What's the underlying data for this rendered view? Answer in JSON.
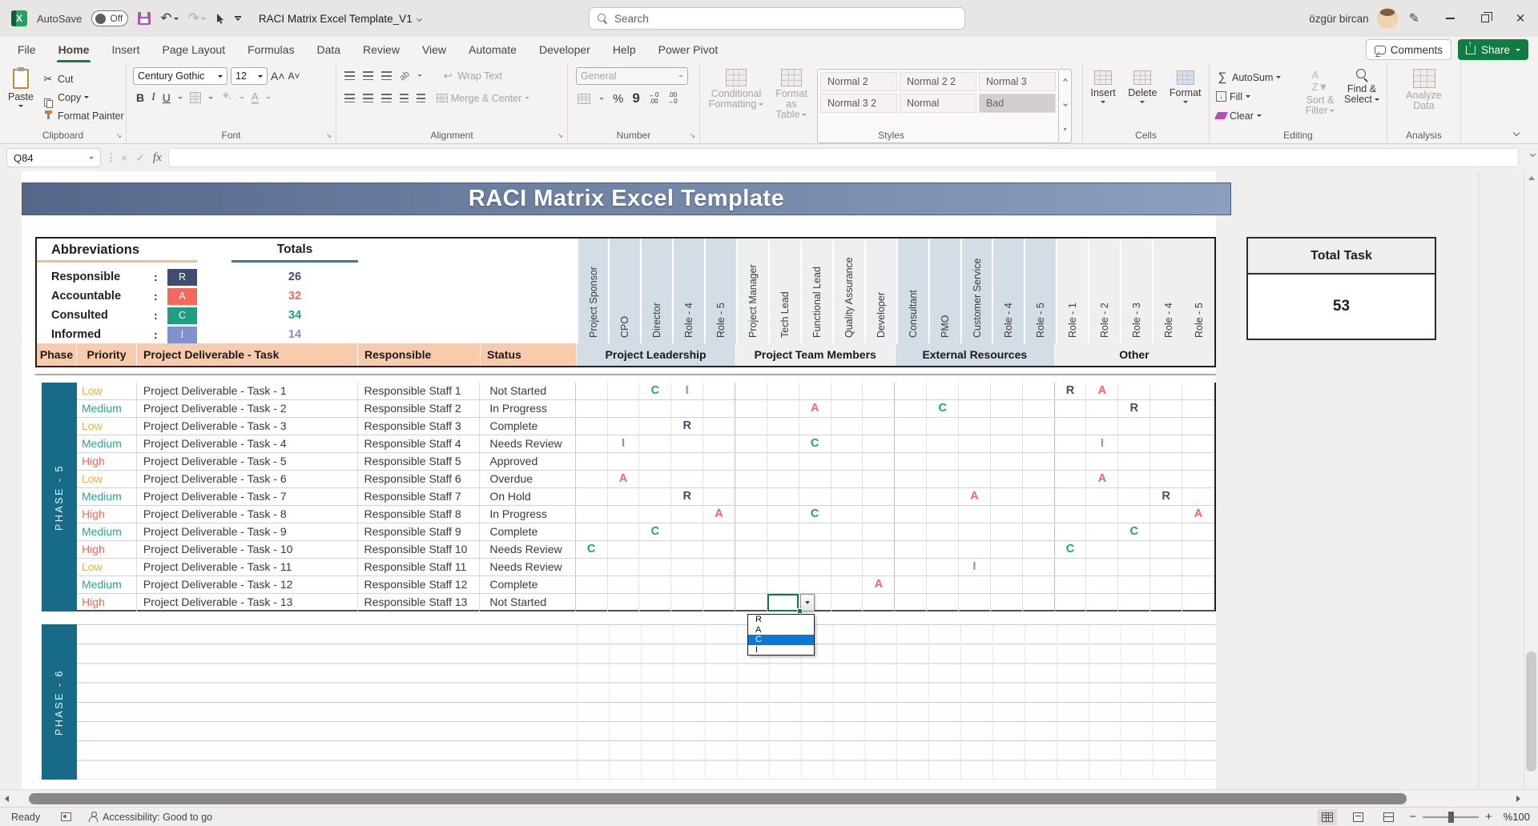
{
  "titlebar": {
    "autosave_label": "AutoSave",
    "autosave_state": "Off",
    "doc_title": "RACI Matrix Excel Template_V1",
    "search_placeholder": "Search",
    "user_name": "özgür bircan"
  },
  "tabs": {
    "items": [
      "File",
      "Home",
      "Insert",
      "Page Layout",
      "Formulas",
      "Data",
      "Review",
      "View",
      "Automate",
      "Developer",
      "Help",
      "Power Pivot"
    ],
    "active": "Home",
    "comments_label": "Comments",
    "share_label": "Share"
  },
  "ribbon": {
    "clipboard": {
      "label": "Clipboard",
      "paste": "Paste",
      "cut": "Cut",
      "copy": "Copy",
      "format_painter": "Format Painter"
    },
    "font": {
      "label": "Font",
      "family": "Century Gothic",
      "size": "12"
    },
    "alignment": {
      "label": "Alignment",
      "wrap_text": "Wrap Text",
      "merge_center": "Merge & Center"
    },
    "number": {
      "label": "Number",
      "format": "General"
    },
    "styles": {
      "label": "Styles",
      "conditional_formatting_1": "Conditional",
      "conditional_formatting_2": "Formatting",
      "format_as_table_1": "Format as",
      "format_as_table_2": "Table",
      "gallery": [
        "Normal 2",
        "Normal 2 2",
        "Normal 3",
        "Normal 3 2",
        "Normal",
        "Bad"
      ]
    },
    "cells": {
      "label": "Cells",
      "insert": "Insert",
      "delete": "Delete",
      "format": "Format"
    },
    "editing": {
      "label": "Editing",
      "autosum": "AutoSum",
      "fill": "Fill",
      "clear": "Clear",
      "sort_filter_1": "Sort &",
      "sort_filter_2": "Filter",
      "find_select_1": "Find &",
      "find_select_2": "Select"
    },
    "analysis": {
      "label": "Analysis",
      "analyze_1": "Analyze",
      "analyze_2": "Data"
    }
  },
  "formula_bar": {
    "name_box": "Q84"
  },
  "sheet": {
    "banner_title": "RACI Matrix Excel Template",
    "abbreviations": {
      "title": "Abbreviations",
      "totals_title": "Totals",
      "items": [
        {
          "label": "Responsible",
          "letter": "R",
          "total": "26"
        },
        {
          "label": "Accountable",
          "letter": "A",
          "total": "32"
        },
        {
          "label": "Consulted",
          "letter": "C",
          "total": "34"
        },
        {
          "label": "Informed",
          "letter": "I",
          "total": "14"
        }
      ]
    },
    "total_task": {
      "title": "Total Task",
      "value": "53"
    },
    "matrix": {
      "column_headers": {
        "phase": "Phase",
        "priority": "Priority",
        "task": "Project Deliverable - Task",
        "responsible": "Responsible",
        "status": "Status"
      },
      "groups": [
        {
          "label": "Project Leadership",
          "shade": "dark",
          "roles": [
            "Project Sponsor",
            "CPO",
            "Director",
            "Role - 4",
            "Role - 5"
          ]
        },
        {
          "label": "Project Team Members",
          "shade": "light",
          "roles": [
            "Project Manager",
            "Tech Lead",
            "Functional Lead",
            "Quality Assurance",
            "Developer"
          ]
        },
        {
          "label": "External Resources",
          "shade": "dark",
          "roles": [
            "Consultant",
            "PMO",
            "Customer Service",
            "Role - 4",
            "Role - 5"
          ]
        },
        {
          "label": "Other",
          "shade": "light",
          "roles": [
            "Role - 1",
            "Role - 2",
            "Role - 3",
            "Role - 4",
            "Role - 5"
          ]
        }
      ],
      "phase5_label": "PHASE - 5",
      "phase6_label": "PHASE - 6",
      "rows": [
        {
          "priority": "Low",
          "task": "Project Deliverable - Task - 1",
          "responsible": "Responsible Staff 1",
          "status": "Not Started",
          "marks": {
            "3": "C",
            "4": "I",
            "16": "R",
            "17": "A"
          }
        },
        {
          "priority": "Medium",
          "task": "Project Deliverable - Task - 2",
          "responsible": "Responsible Staff 2",
          "status": "In Progress",
          "marks": {
            "8": "A",
            "12": "C",
            "18": "R"
          }
        },
        {
          "priority": "Low",
          "task": "Project Deliverable - Task - 3",
          "responsible": "Responsible Staff 3",
          "status": "Complete",
          "marks": {
            "4": "R"
          }
        },
        {
          "priority": "Medium",
          "task": "Project Deliverable - Task - 4",
          "responsible": "Responsible Staff 4",
          "status": "Needs Review",
          "marks": {
            "2": "I",
            "8": "C",
            "17": "I"
          }
        },
        {
          "priority": "High",
          "task": "Project Deliverable - Task - 5",
          "responsible": "Responsible Staff 5",
          "status": "Approved",
          "marks": {}
        },
        {
          "priority": "Low",
          "task": "Project Deliverable - Task - 6",
          "responsible": "Responsible Staff 6",
          "status": "Overdue",
          "marks": {
            "2": "A",
            "17": "A"
          }
        },
        {
          "priority": "Medium",
          "task": "Project Deliverable - Task - 7",
          "responsible": "Responsible Staff 7",
          "status": "On Hold",
          "marks": {
            "4": "R",
            "13": "A",
            "19": "R"
          }
        },
        {
          "priority": "High",
          "task": "Project Deliverable - Task - 8",
          "responsible": "Responsible Staff 8",
          "status": "In Progress",
          "marks": {
            "5": "A",
            "8": "C",
            "20": "A"
          }
        },
        {
          "priority": "Medium",
          "task": "Project Deliverable - Task - 9",
          "responsible": "Responsible Staff 9",
          "status": "Complete",
          "marks": {
            "3": "C",
            "18": "C"
          }
        },
        {
          "priority": "High",
          "task": "Project Deliverable - Task - 10",
          "responsible": "Responsible Staff 10",
          "status": "Needs Review",
          "marks": {
            "1": "C",
            "16": "C"
          }
        },
        {
          "priority": "Low",
          "task": "Project Deliverable - Task - 11",
          "responsible": "Responsible Staff 11",
          "status": "Needs Review",
          "marks": {
            "13": "I"
          }
        },
        {
          "priority": "Medium",
          "task": "Project Deliverable - Task - 12",
          "responsible": "Responsible Staff 12",
          "status": "Complete",
          "marks": {
            "10": "A"
          }
        },
        {
          "priority": "High",
          "task": "Project Deliverable - Task - 13",
          "responsible": "Responsible Staff 13",
          "status": "Not Started",
          "marks": {},
          "selected_col": 7
        }
      ]
    },
    "dropdown": {
      "options": [
        "R",
        "A",
        "C",
        "I"
      ],
      "selected": "C"
    }
  },
  "status_bar": {
    "ready": "Ready",
    "accessibility": "Accessibility: Good to go",
    "zoom": "%100"
  },
  "colors": {
    "responsible": "#3F4E6E",
    "accountable": "#F4695E",
    "consulted": "#1F9E83",
    "informed": "#8290CB",
    "priority_low": "#EFAF3C",
    "priority_medium": "#2EA198",
    "priority_high": "#F4695E",
    "phase": "#176B87",
    "header_band": "#F8CBAD",
    "accent_green": "#107C41",
    "dropdown_highlight": "#0B78D7"
  }
}
